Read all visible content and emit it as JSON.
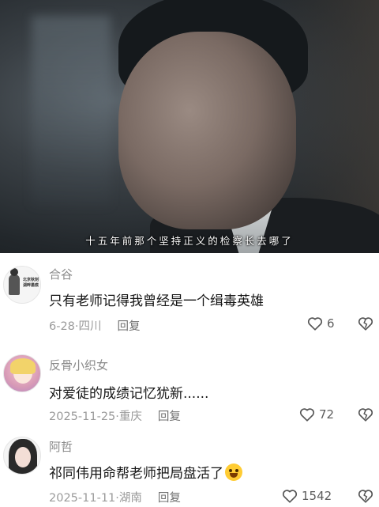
{
  "video": {
    "subtitle": "十五年前那个坚持正义的检察长去哪了"
  },
  "comments": [
    {
      "avatar_text": "北京秋刻 湖畔墨痕",
      "username": "合谷",
      "text": "只有老师记得我曾经是一个缉毒英雄",
      "date": "6-28",
      "location": "四川",
      "reply_label": "回复",
      "likes": "6",
      "like_icon": "heart-outline-icon",
      "dislike_icon": "broken-heart-icon"
    },
    {
      "username": "反骨小织女",
      "text": "对爱徒的成绩记忆犹新......",
      "date": "2025-11-25",
      "location": "重庆",
      "reply_label": "回复",
      "likes": "72",
      "like_icon": "heart-outline-icon",
      "dislike_icon": "broken-heart-icon"
    },
    {
      "username": "阿哲",
      "text": "祁同伟用命帮老师把局盘活了",
      "emoji": "grimacing-face-emoji",
      "date": "2025-11-11",
      "location": "湖南",
      "reply_label": "回复",
      "likes": "1542",
      "like_icon": "heart-outline-icon",
      "dislike_icon": "broken-heart-icon"
    }
  ],
  "separator": "·"
}
